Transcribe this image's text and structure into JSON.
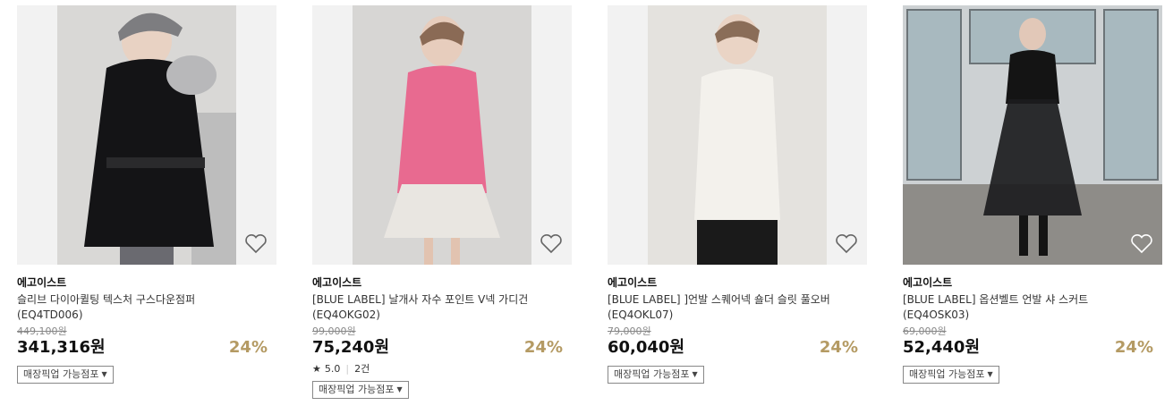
{
  "products": [
    {
      "brand": "에고이스트",
      "name": "슬리브 다이아퀼팅 텍스처 구스다운점퍼",
      "code": "(EQ4TD006)",
      "original_price": "449,100원",
      "sale_price": "341,316원",
      "discount": "24%",
      "pickup_label": "매장픽업 가능점포",
      "image_desc": "model in black down jacket with fur hood"
    },
    {
      "brand": "에고이스트",
      "name": "[BLUE LABEL] 날개사 자수 포인트 V넥 가디건",
      "code": "(EQ4OKG02)",
      "original_price": "99,000원",
      "sale_price": "75,240원",
      "discount": "24%",
      "rating_star": "★",
      "rating": "5.0",
      "review_count": "2건",
      "pickup_label": "매장픽업 가능점포",
      "image_desc": "model in pink cardigan and white skirt"
    },
    {
      "brand": "에고이스트",
      "name": "[BLUE LABEL] ]언발 스퀘어넥 숄더 슬릿 풀오버",
      "code": "(EQ4OKL07)",
      "original_price": "79,000원",
      "sale_price": "60,040원",
      "discount": "24%",
      "pickup_label": "매장픽업 가능점포",
      "image_desc": "model in white knit pullover"
    },
    {
      "brand": "에고이스트",
      "name": "[BLUE LABEL] 옵션벨트 언발 샤 스커트",
      "code": "(EQ4OSK03)",
      "original_price": "69,000원",
      "sale_price": "52,440원",
      "discount": "24%",
      "pickup_label": "매장픽업 가능점포",
      "image_desc": "model in black tulle skirt outfit"
    }
  ]
}
